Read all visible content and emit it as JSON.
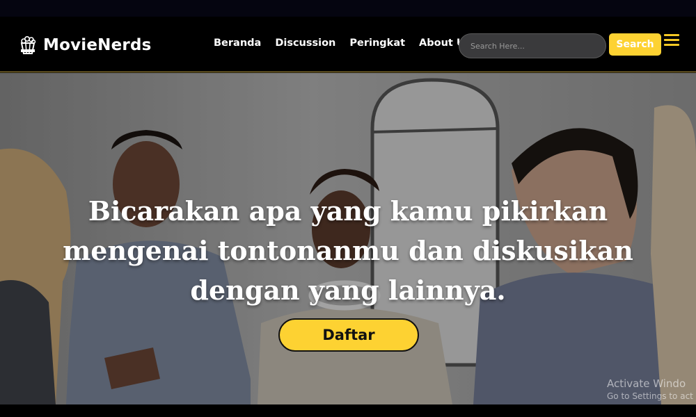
{
  "brand": {
    "name": "MovieNerds",
    "icon": "popcorn-icon"
  },
  "nav": {
    "links": [
      "Beranda",
      "Discussion",
      "Peringkat",
      "About Us"
    ]
  },
  "search": {
    "placeholder": "Search Here...",
    "value": "",
    "button_label": "Search"
  },
  "hero": {
    "headline": "Bicarakan apa yang kamu pikirkan mengenai tontonanmu dan diskusikan dengan yang lainnya.",
    "cta_label": "Daftar"
  },
  "watermark": {
    "title": "Activate Windo",
    "subtitle": "Go to Settings to act"
  },
  "colors": {
    "accent": "#fdd232",
    "navbar_bg": "#000000",
    "nav_border": "#b79a3c"
  }
}
